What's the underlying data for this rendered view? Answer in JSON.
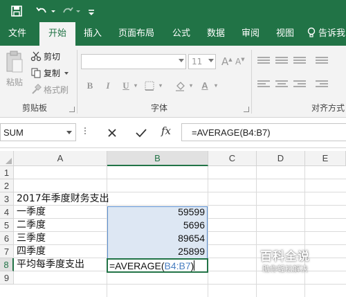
{
  "colors": {
    "brand": "#217346",
    "selection_fill": "#dde7f3",
    "reference": "#4a7fc1"
  },
  "titlebar": {
    "icons": [
      "save-icon",
      "undo-icon",
      "redo-icon",
      "customize-icon"
    ]
  },
  "tabs": [
    {
      "label": "文件",
      "active": false
    },
    {
      "label": "开始",
      "active": true
    },
    {
      "label": "插入",
      "active": false
    },
    {
      "label": "页面布局",
      "active": false
    },
    {
      "label": "公式",
      "active": false
    },
    {
      "label": "数据",
      "active": false
    },
    {
      "label": "审阅",
      "active": false
    },
    {
      "label": "视图",
      "active": false
    },
    {
      "label": "告诉我",
      "active": false
    }
  ],
  "ribbon": {
    "clipboard": {
      "paste_label": "粘贴",
      "cut_label": "剪切",
      "copy_label": "复制",
      "format_painter_label": "格式刷",
      "group_label": "剪贴板"
    },
    "font": {
      "font_name": "",
      "font_size": "11",
      "group_label": "字体"
    },
    "alignment": {
      "group_label": "对齐方式"
    }
  },
  "formula_bar": {
    "name_box": "SUM",
    "cancel_icon": "close-icon",
    "enter_icon": "check-icon",
    "fx_label": "fx",
    "formula": "=AVERAGE(B4:B7)"
  },
  "sheet": {
    "columns": [
      "A",
      "B",
      "C",
      "D",
      "E"
    ],
    "selected_column": "B",
    "rows": [
      "1",
      "2",
      "3",
      "4",
      "5",
      "6",
      "7",
      "8",
      "9"
    ],
    "selected_row": "8",
    "cells": {
      "A3": "2017年季度财务支出",
      "A4": "一季度",
      "A5": "二季度",
      "A6": "三季度",
      "A7": "四季度",
      "A8": "平均每季度支出",
      "B4": "59599",
      "B5": "5696",
      "B6": "89654",
      "B7": "25899"
    },
    "editing_cell": {
      "prefix": "=AVERAGE(",
      "reference": "B4:B7",
      "suffix": ")"
    }
  },
  "watermark": {
    "title": "百科全说",
    "subtitle": "助你轻松解决"
  }
}
